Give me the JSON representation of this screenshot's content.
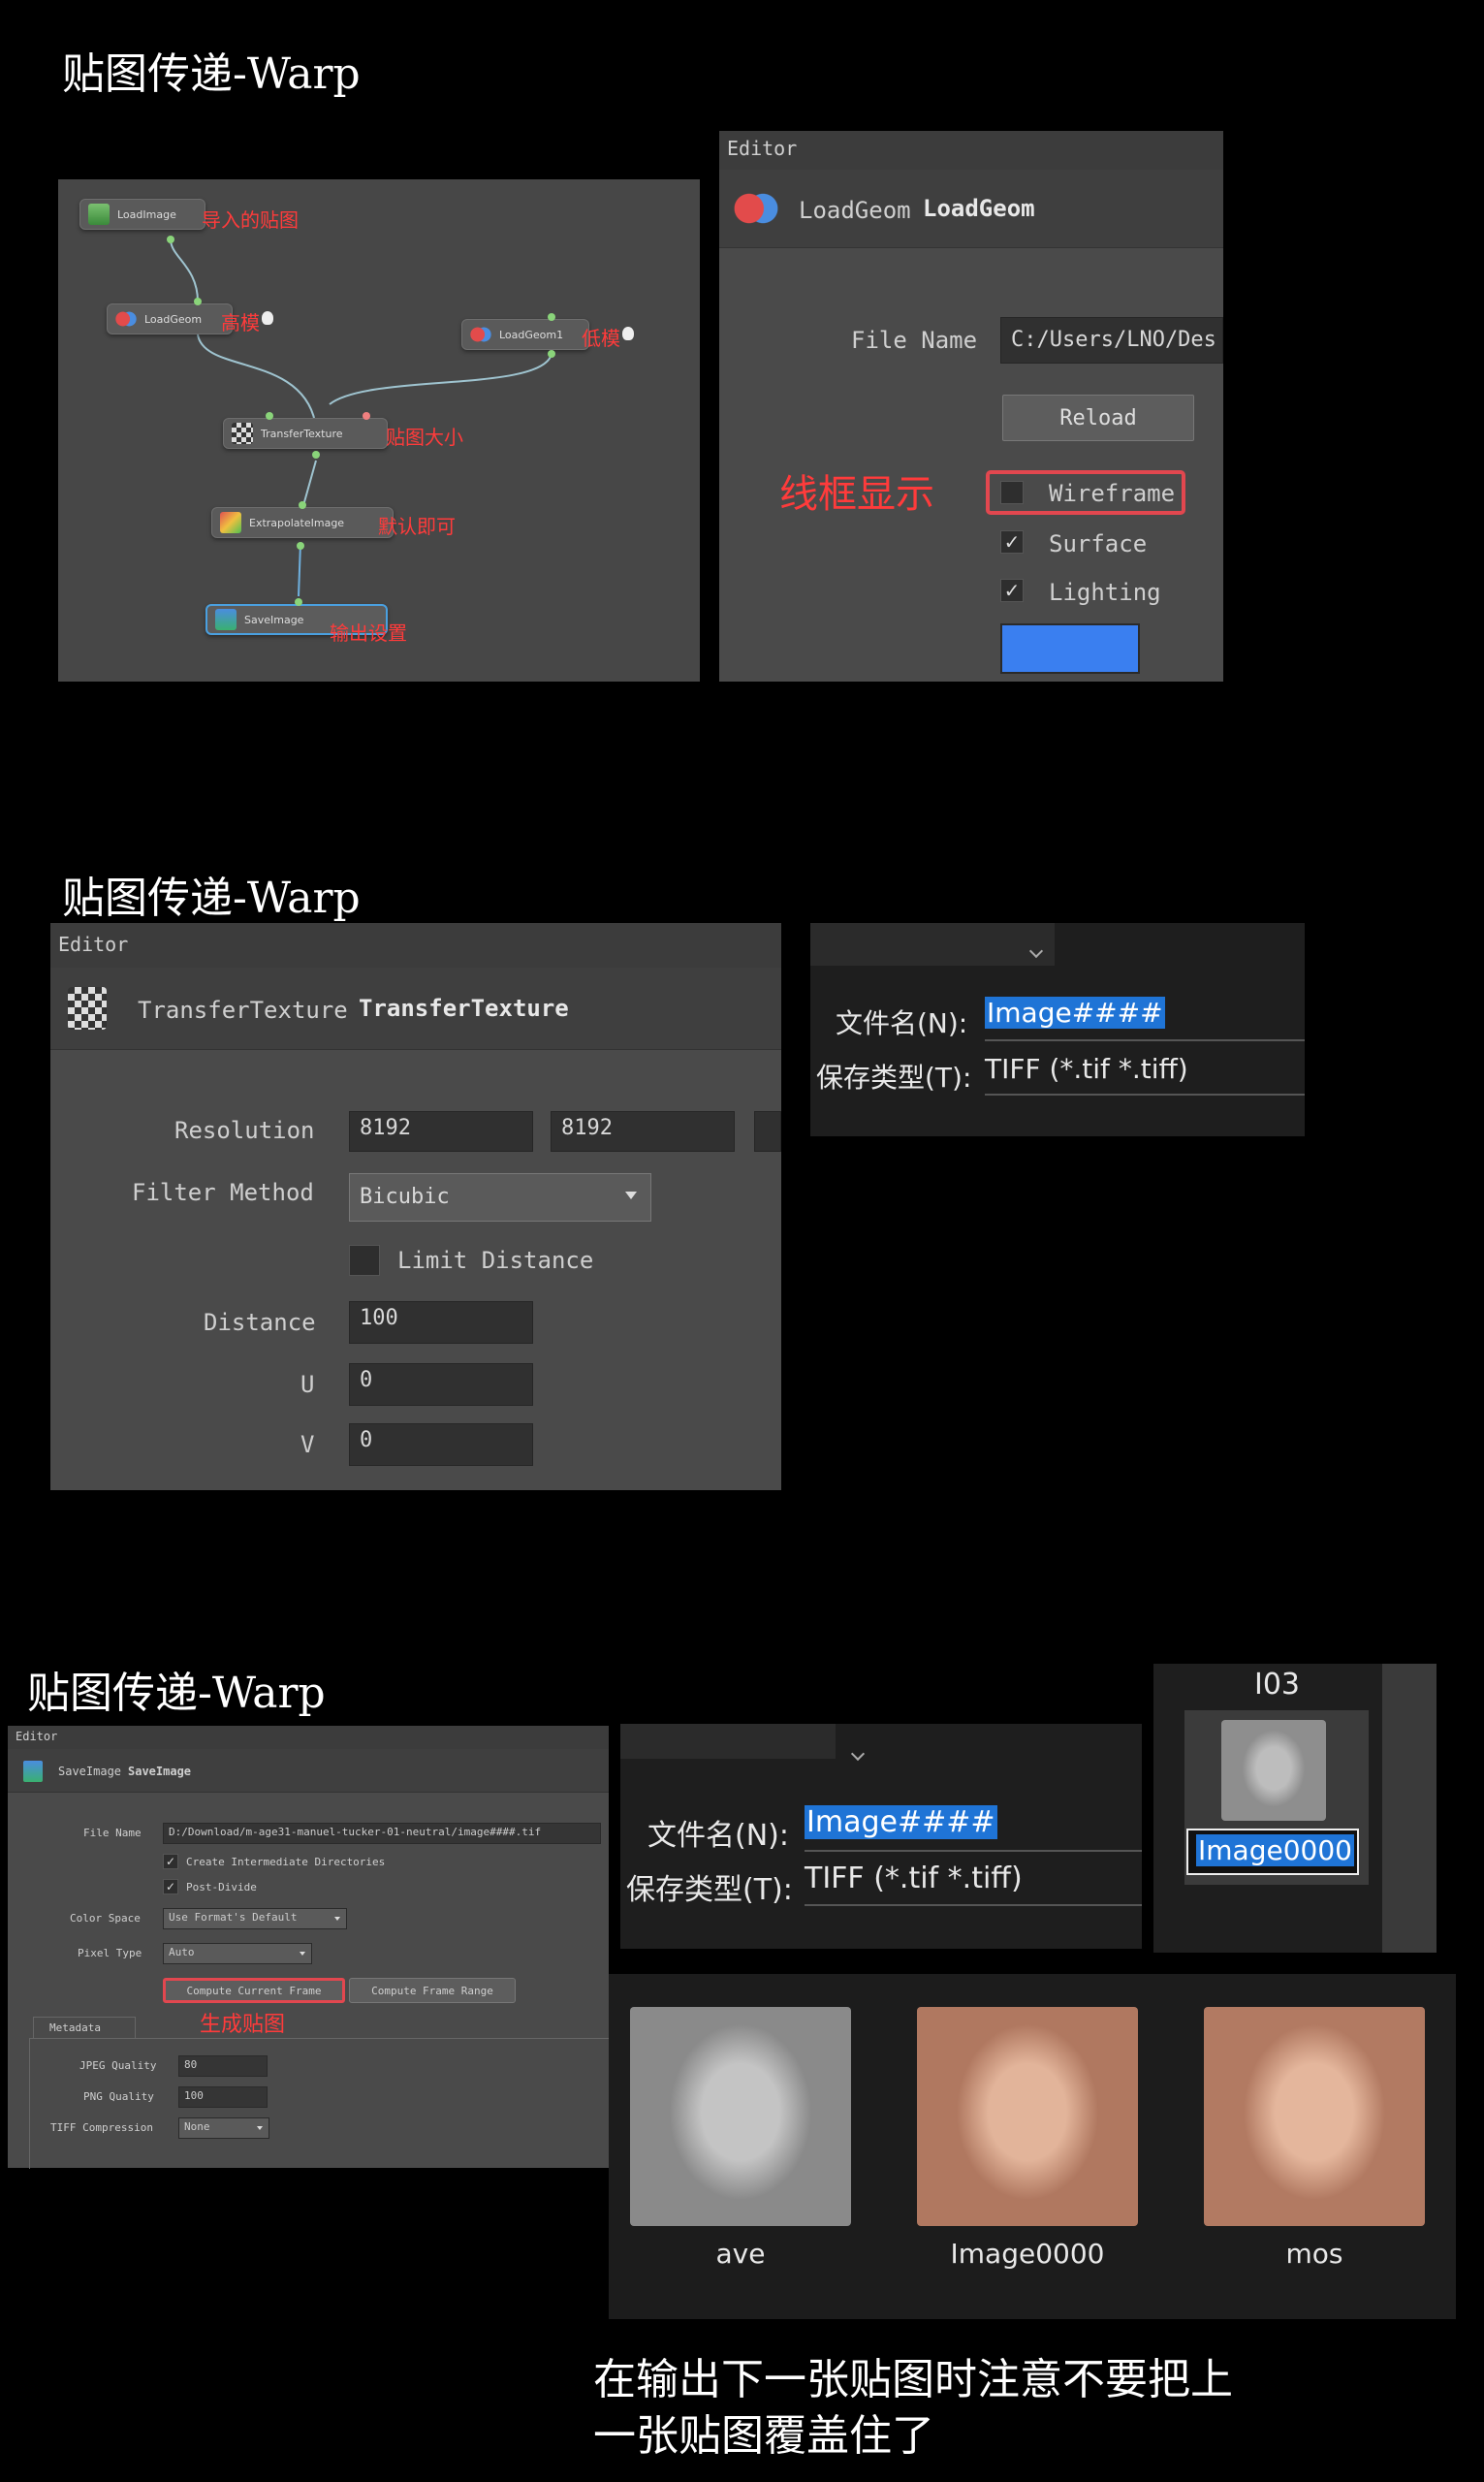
{
  "section_titles": [
    "贴图传递-Warp",
    "贴图传递-Warp",
    "贴图传递-Warp"
  ],
  "node_graph": {
    "nodes": [
      {
        "label": "LoadImage",
        "annotation": "导入的贴图"
      },
      {
        "label": "LoadGeom",
        "annotation": "高模"
      },
      {
        "label": "LoadGeom1",
        "annotation": "低模"
      },
      {
        "label": "TransferTexture",
        "annotation": "贴图大小"
      },
      {
        "label": "ExtrapolateImage",
        "annotation": "默认即可"
      },
      {
        "label": "SaveImage",
        "annotation": "输出设置"
      }
    ]
  },
  "loadgeom_editor": {
    "header": "Editor",
    "node_type": "LoadGeom",
    "node_name": "LoadGeom",
    "file_name_label": "File Name",
    "file_name_value": "C:/Users/LNO/Des",
    "reload_label": "Reload",
    "wireframe_label": "Wireframe",
    "wireframe_checked": false,
    "wireframe_annotation": "线框显示",
    "surface_label": "Surface",
    "surface_checked": true,
    "lighting_label": "Lighting",
    "lighting_checked": true,
    "color_swatch": "#3a7ff0"
  },
  "transfer_editor": {
    "header": "Editor",
    "node_type": "TransferTexture",
    "node_name": "TransferTexture",
    "resolution_label": "Resolution",
    "resolution_x": "8192",
    "resolution_y": "8192",
    "filter_label": "Filter Method",
    "filter_value": "Bicubic",
    "limit_distance_label": "Limit Distance",
    "distance_label": "Distance",
    "distance_value": "100",
    "u_label": "U",
    "u_value": "0",
    "v_label": "V",
    "v_value": "0"
  },
  "save_dialog": {
    "filename_label": "文件名(N):",
    "filename_value": "Image####",
    "type_label": "保存类型(T):",
    "type_value": "TIFF (*.tif *.tiff)"
  },
  "saveimage_editor": {
    "header": "Editor",
    "node_type": "SaveImage",
    "node_name": "SaveImage",
    "file_name_label": "File Name",
    "file_name_value": "D:/Download/m-age31-manuel-tucker-01-neutral/image####.tif",
    "create_dirs_label": "Create Intermediate Directories",
    "post_divide_label": "Post-Divide",
    "color_space_label": "Color Space",
    "color_space_value": "Use Format's Default",
    "pixel_type_label": "Pixel Type",
    "pixel_type_value": "Auto",
    "compute_current_label": "Compute Current Frame",
    "compute_range_label": "Compute Frame Range",
    "compute_annotation": "生成贴图",
    "metadata_tab": "Metadata",
    "jpeg_quality_label": "JPEG Quality",
    "jpeg_quality_value": "80",
    "png_quality_label": "PNG Quality",
    "png_quality_value": "100",
    "tiff_comp_label": "TIFF Compression",
    "tiff_comp_value": "None"
  },
  "explorer_rename": {
    "folder_label": "I03",
    "rename_value": "Image0000"
  },
  "thumbnails": [
    {
      "label": "ave",
      "tone": "gray"
    },
    {
      "label": "Image0000",
      "tone": "skin"
    },
    {
      "label": "mos",
      "tone": "skin"
    }
  ],
  "note_line1": "在输出下一张贴图时注意不要把上",
  "note_line2": "一张贴图覆盖住了"
}
